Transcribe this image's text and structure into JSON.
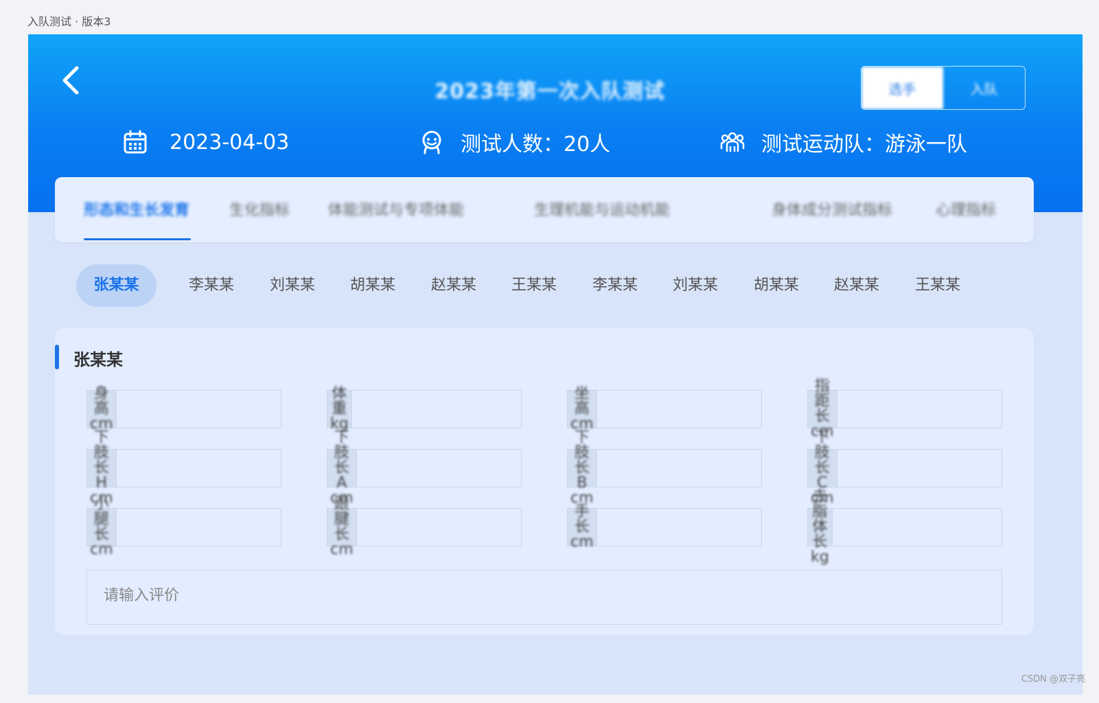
{
  "caption": "入队测试 · 版本3",
  "header": {
    "title": "2023年第一次入队测试",
    "toggle": {
      "left": "选手",
      "right": "入队"
    },
    "date": "2023-04-03",
    "count": "测试人数：20人",
    "team": "测试运动队：游泳一队"
  },
  "tabs": [
    {
      "label": "形态和生长发育"
    },
    {
      "label": "生化指标"
    },
    {
      "label": "体能测试与专项体能"
    },
    {
      "label": "生理机能与运动机能"
    },
    {
      "label": "身体成分测试指标"
    },
    {
      "label": "心理指标"
    }
  ],
  "athletes": [
    "张某某",
    "李某某",
    "刘某某",
    "胡某某",
    "赵某某",
    "王某某",
    "李某某",
    "刘某某",
    "胡某某",
    "赵某某",
    "王某某"
  ],
  "form": {
    "section_title": "张某某",
    "fields": [
      {
        "label": "身高cm"
      },
      {
        "label": "体重kg"
      },
      {
        "label": "坐高cm"
      },
      {
        "label": "指距长cm"
      },
      {
        "label": "下肢长H cm"
      },
      {
        "label": "下肢长A cm"
      },
      {
        "label": "下肢长B cm"
      },
      {
        "label": "下肢长C cm"
      },
      {
        "label": "小腿长 cm"
      },
      {
        "label": "跟腱长cm"
      },
      {
        "label": "手长cm"
      },
      {
        "label": "去脂体长kg"
      }
    ],
    "comment_placeholder": "请输入评价"
  },
  "watermark": "CSDN @双子亮",
  "colors": {
    "primary": "#1a73e8",
    "header_top": "#10a4f8",
    "header_bottom": "#0671ee"
  }
}
